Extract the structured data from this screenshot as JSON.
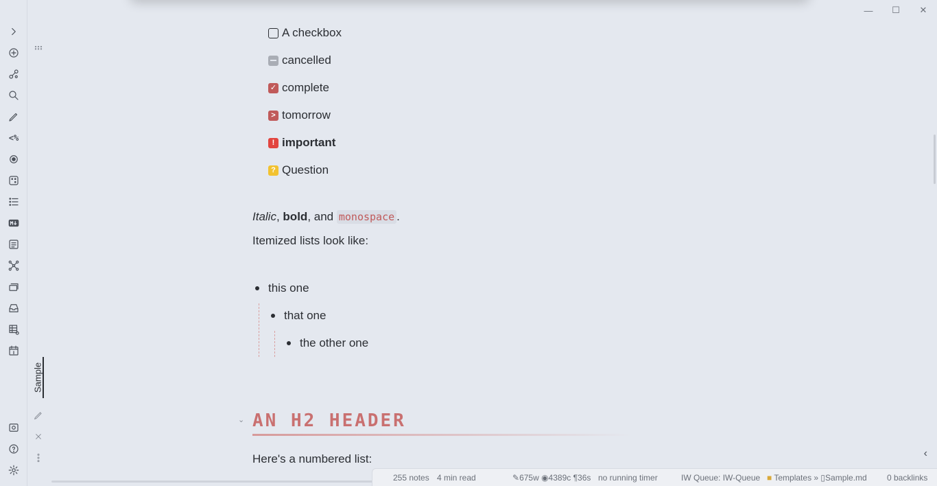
{
  "window": {
    "minimize": "—",
    "maximize": "☐",
    "close": "✕"
  },
  "ribbon": {
    "expand": "›",
    "templater": "<%",
    "items": [
      "new-note-icon",
      "graph-links-icon",
      "search-icon",
      "pencil-icon",
      "templater-icon",
      "record-icon",
      "dice-icon",
      "list-icon",
      "markdown-icon",
      "outline-icon",
      "graph-view-icon",
      "stack-icon",
      "inbox-icon",
      "table-icon",
      "calendar-icon"
    ],
    "bottom": [
      "vault-icon",
      "help-icon",
      "settings-icon"
    ]
  },
  "tab": {
    "title": "Sample"
  },
  "tasks": [
    {
      "state": "empty",
      "mark": "",
      "label": "A checkbox"
    },
    {
      "state": "cancel",
      "mark": "",
      "label": "cancelled"
    },
    {
      "state": "done",
      "mark": "✓",
      "label": "complete"
    },
    {
      "state": "tomorrow",
      "mark": ">",
      "label": "tomorrow"
    },
    {
      "state": "important",
      "mark": "!",
      "label": "important"
    },
    {
      "state": "question",
      "mark": "?",
      "label": "Question"
    }
  ],
  "para1": {
    "italic": "Italic",
    "sep1": ", ",
    "bold": "bold",
    "sep2": ", and ",
    "mono": "monospace",
    "end": "."
  },
  "para2": "Itemized lists look like:",
  "list": [
    "this one",
    "that one",
    "the other one"
  ],
  "heading": "AN H2 HEADER",
  "para3": "Here's a numbered list:",
  "status": {
    "notes": "255 notes",
    "read": "4 min read",
    "counts": "675w ◉4389c ¶36s",
    "timer": "no running timer",
    "queue": "IW Queue: IW-Queue",
    "path": "Templates »",
    "file": "Sample.md",
    "backlinks": "0 backlinks"
  }
}
